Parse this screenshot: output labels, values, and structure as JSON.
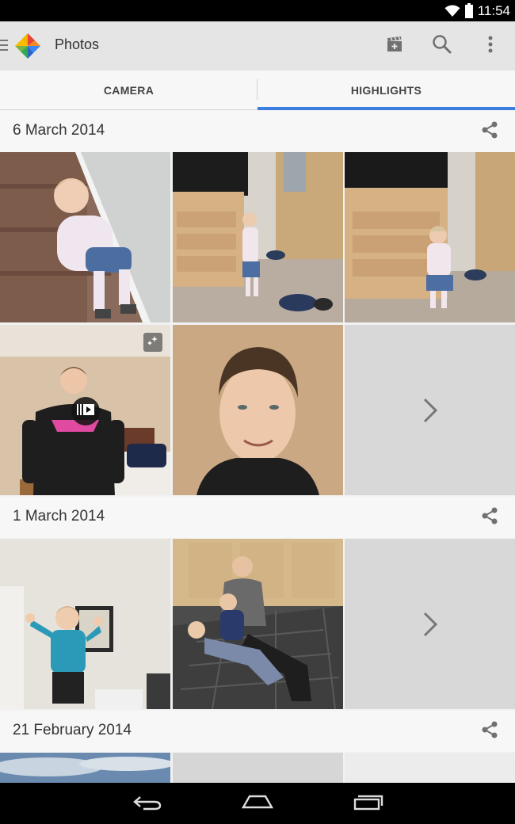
{
  "status_bar": {
    "time": "11:54",
    "icons": [
      "wifi-icon",
      "battery-icon"
    ]
  },
  "app_bar": {
    "title": "Photos",
    "actions": [
      "movie-maker-icon",
      "search-icon",
      "overflow-menu-icon"
    ]
  },
  "tabs": [
    {
      "label": "CAMERA",
      "selected": false
    },
    {
      "label": "HIGHLIGHTS",
      "selected": true
    }
  ],
  "accent_color": "#3a7ee0",
  "sections": [
    {
      "date": "6 March 2014",
      "photos": 5,
      "has_more": true
    },
    {
      "date": "1 March 2014",
      "photos": 2,
      "has_more": true
    },
    {
      "date": "21 February 2014",
      "photos": 1,
      "has_more": false
    }
  ],
  "nav_bar": {
    "buttons": [
      "back-icon",
      "home-icon",
      "recents-icon"
    ]
  }
}
